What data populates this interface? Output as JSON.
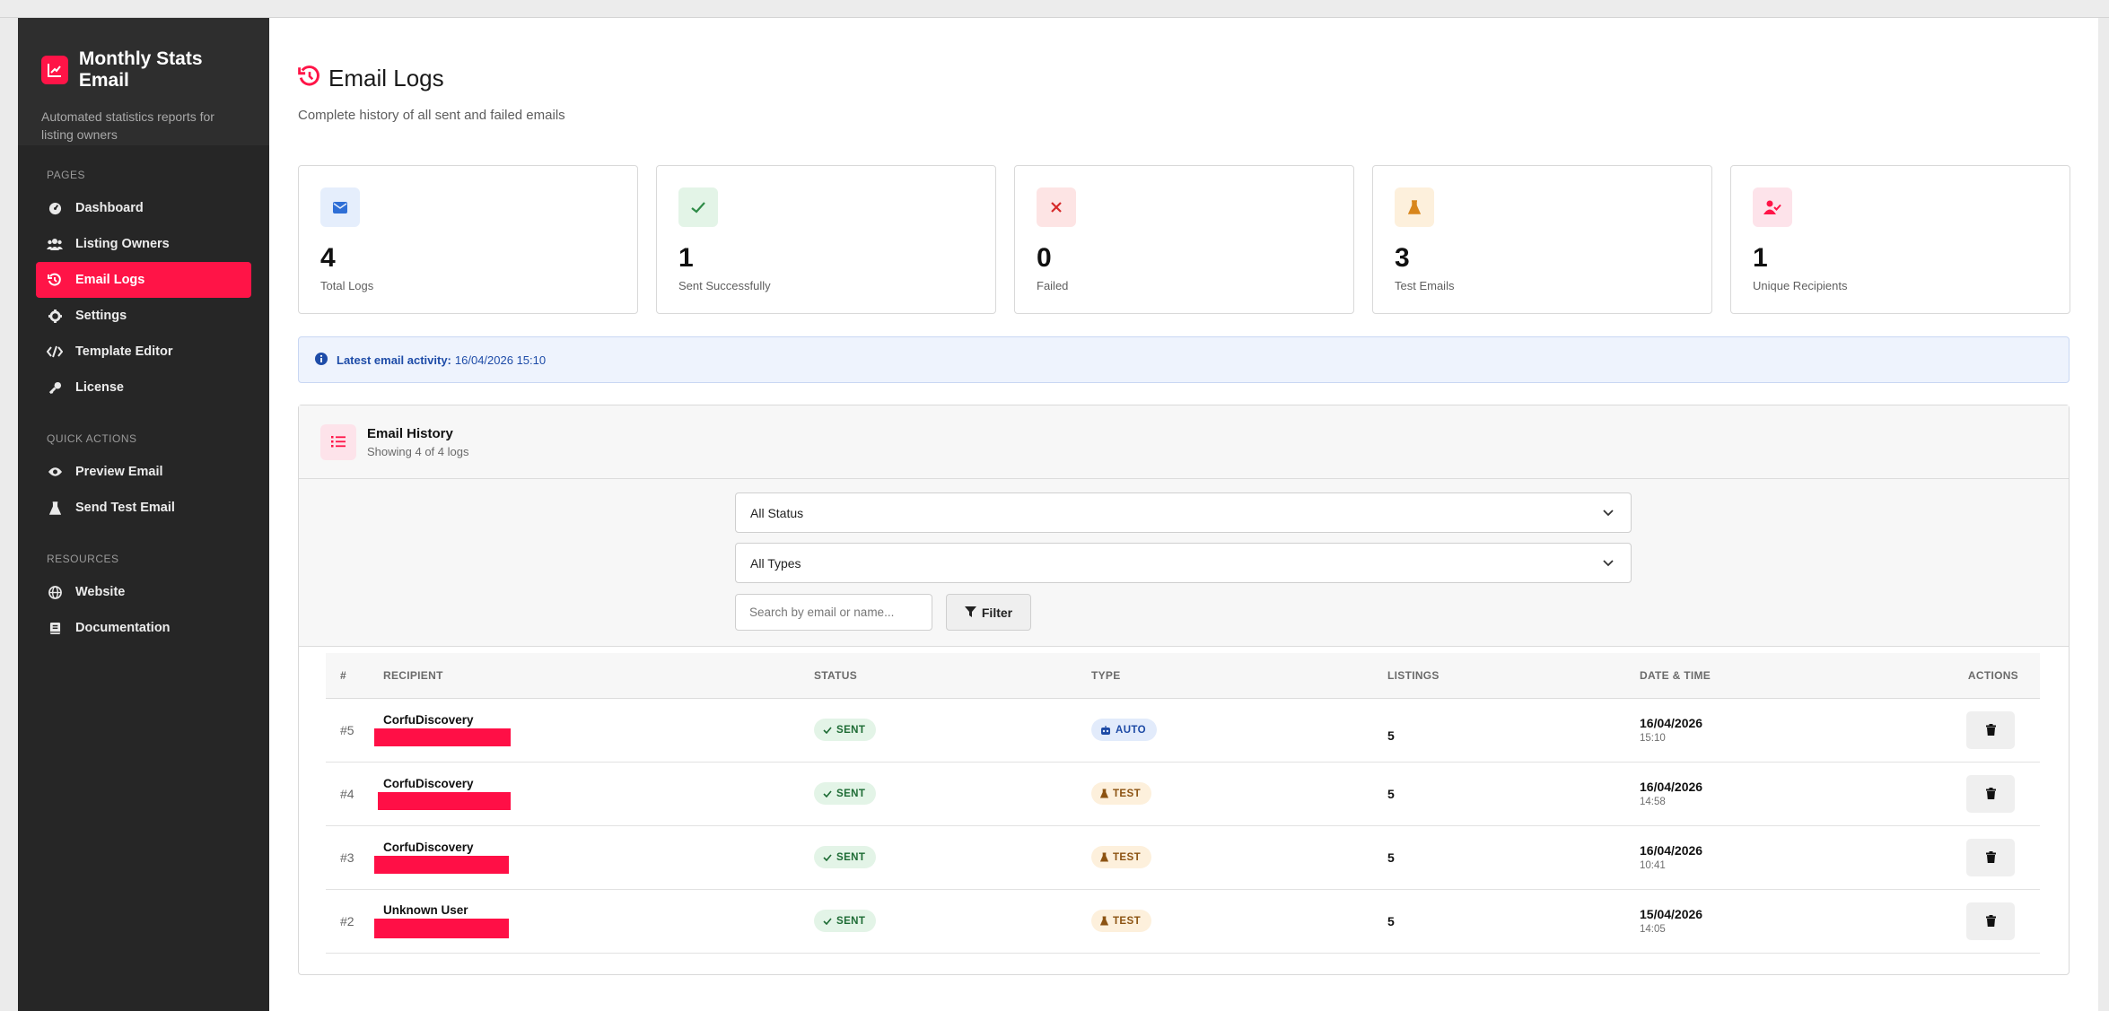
{
  "sidebar": {
    "brand_title": "Monthly Stats Email",
    "brand_subtitle": "Automated statistics reports for listing owners",
    "sections": [
      {
        "label": "PAGES",
        "items": [
          {
            "label": "Dashboard",
            "icon": "dashboard-icon"
          },
          {
            "label": "Listing Owners",
            "icon": "users-icon"
          },
          {
            "label": "Email Logs",
            "icon": "history-icon",
            "active": true
          },
          {
            "label": "Settings",
            "icon": "gear-icon"
          },
          {
            "label": "Template Editor",
            "icon": "code-icon"
          },
          {
            "label": "License",
            "icon": "key-icon"
          }
        ]
      },
      {
        "label": "QUICK ACTIONS",
        "items": [
          {
            "label": "Preview Email",
            "icon": "eye-icon"
          },
          {
            "label": "Send Test Email",
            "icon": "flask-icon"
          }
        ]
      },
      {
        "label": "RESOURCES",
        "items": [
          {
            "label": "Website",
            "icon": "globe-icon"
          },
          {
            "label": "Documentation",
            "icon": "book-icon"
          }
        ]
      }
    ]
  },
  "header": {
    "title": "Email Logs",
    "subtitle": "Complete history of all sent and failed emails"
  },
  "stats": [
    {
      "value": "4",
      "label": "Total Logs",
      "icon": "envelope-icon",
      "color": "#2f6fd6",
      "bg": "#e5eefc"
    },
    {
      "value": "1",
      "label": "Sent Successfully",
      "icon": "check-icon",
      "color": "#2e8b47",
      "bg": "#e3f4e7"
    },
    {
      "value": "0",
      "label": "Failed",
      "icon": "x-icon",
      "color": "#d62a2a",
      "bg": "#fde4e4"
    },
    {
      "value": "3",
      "label": "Test Emails",
      "icon": "flask-icon",
      "color": "#d8861c",
      "bg": "#fdf0dc"
    },
    {
      "value": "1",
      "label": "Unique Recipients",
      "icon": "user-check-icon",
      "color": "#ff1447",
      "bg": "#fde3ea"
    }
  ],
  "notice": {
    "label": "Latest email activity:",
    "value": "16/04/2026 15:10"
  },
  "history": {
    "title": "Email History",
    "subtitle": "Showing 4 of 4 logs",
    "status_select": "All Status",
    "type_select": "All Types",
    "search_placeholder": "Search by email or name...",
    "filter_label": "Filter",
    "columns": [
      "#",
      "RECIPIENT",
      "STATUS",
      "TYPE",
      "LISTINGS",
      "DATE & TIME",
      "ACTIONS"
    ],
    "rows": [
      {
        "num": "#5",
        "recipient": "CorfuDiscovery",
        "status": "SENT",
        "type": "AUTO",
        "listings": "5",
        "date": "16/04/2026",
        "time": "15:10"
      },
      {
        "num": "#4",
        "recipient": "CorfuDiscovery",
        "status": "SENT",
        "type": "TEST",
        "listings": "5",
        "date": "16/04/2026",
        "time": "14:58"
      },
      {
        "num": "#3",
        "recipient": "CorfuDiscovery",
        "status": "SENT",
        "type": "TEST",
        "listings": "5",
        "date": "16/04/2026",
        "time": "10:41"
      },
      {
        "num": "#2",
        "recipient": "Unknown User",
        "status": "SENT",
        "type": "TEST",
        "listings": "5",
        "date": "15/04/2026",
        "time": "14:05"
      }
    ]
  },
  "colors": {
    "accent": "#ff1447",
    "sidebar_bg": "#262626"
  }
}
